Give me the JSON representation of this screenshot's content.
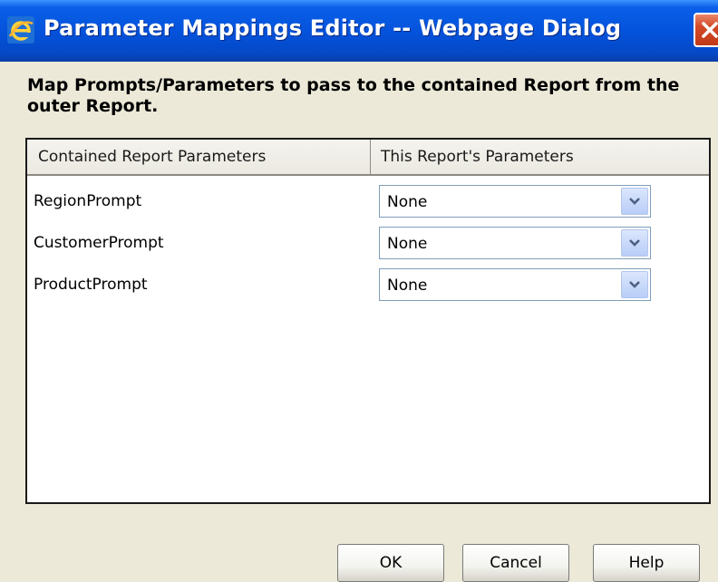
{
  "window": {
    "title": "Parameter Mappings Editor -- Webpage Dialog"
  },
  "heading": "Map Prompts/Parameters to pass to the contained Report from the outer Report.",
  "grid": {
    "columns": [
      "Contained Report Parameters",
      "This Report's Parameters"
    ],
    "rows": [
      {
        "parameter": "RegionPrompt",
        "mapping": "None"
      },
      {
        "parameter": "CustomerPrompt",
        "mapping": "None"
      },
      {
        "parameter": "ProductPrompt",
        "mapping": "None"
      }
    ]
  },
  "buttons": {
    "ok": "OK",
    "cancel": "Cancel",
    "help": "Help"
  },
  "icons": {
    "app": "ie-icon",
    "close": "close-icon",
    "dropdown": "chevron-down-icon"
  },
  "colors": {
    "titlebar": "#0553dc",
    "dialog_bg": "#ece9d8",
    "close_btn": "#d24a28",
    "dropdown_arrow": "#4d6185"
  }
}
